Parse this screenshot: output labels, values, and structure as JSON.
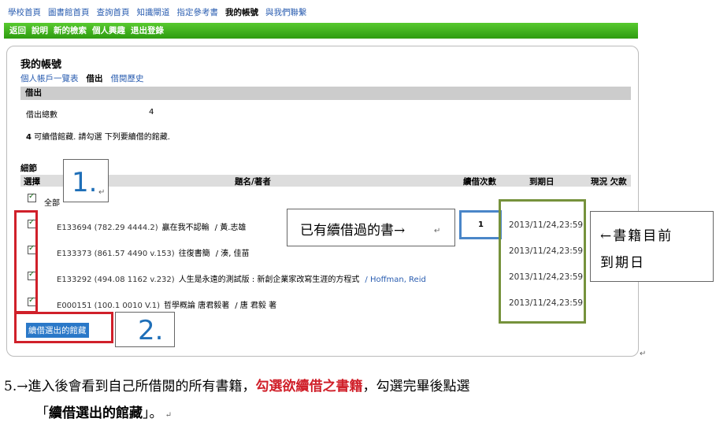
{
  "top_nav": [
    {
      "label": "學校首頁",
      "current": false
    },
    {
      "label": "圖書館首頁",
      "current": false
    },
    {
      "label": "查詢首頁",
      "current": false
    },
    {
      "label": "知識閘道",
      "current": false
    },
    {
      "label": "指定參考書",
      "current": false
    },
    {
      "label": "我的帳號",
      "current": true
    },
    {
      "label": "與我們聯繫",
      "current": false
    }
  ],
  "green_nav": [
    "返回",
    "說明",
    "新的檢索",
    "個人興趣",
    "退出登錄"
  ],
  "account": {
    "title": "我的帳號",
    "tabs": [
      {
        "label": "個人帳戶一覽表",
        "active": false
      },
      {
        "label": "借出",
        "active": true
      },
      {
        "label": "借閱歷史",
        "active": false
      }
    ],
    "loans_header": "借出",
    "total_label": "借出總數",
    "total_value": "4",
    "renew_count": "4",
    "renew_msg": "可續借館藏. 請勾選 下列要續借的館藏."
  },
  "details": {
    "header": "細節",
    "col_select": "選擇",
    "col_title": "題名/著者",
    "col_renewals": "續借次數",
    "col_due": "到期日",
    "col_status": "現況 欠款",
    "select_all": "全部",
    "rows": [
      {
        "call": "E133694 (782.29 4444.2)",
        "title": "贏在我不認輸",
        "author": "/ 黃.志雄",
        "renewals": "1",
        "due": "2013/11/24,23:59"
      },
      {
        "call": "E133373 (861.57 4490 v.153)",
        "title": "往復書簡",
        "author": "/ 湊, 佳苗",
        "renewals": "",
        "due": "2013/11/24,23:59"
      },
      {
        "call": "E133292 (494.08 1162 v.232)",
        "title": "人生是永遠的測試版 : 新創企業家改寫生涯的方程式",
        "author": "/ Hoffman, Reid",
        "renewals": "",
        "due": "2013/11/24,23:59"
      },
      {
        "call": "E000151 (100.1 0010 V.1)",
        "title": "哲學概論 唐君毅著",
        "author": "/ 唐 君毅 著",
        "renewals": "",
        "due": "2013/11/24,23:59"
      }
    ],
    "renew_button": "續借選出的館藏"
  },
  "annotations": {
    "step1": "1.",
    "step2": "2.",
    "renewed_note": "已有續借過的書→",
    "due_note_line1": "←書籍目前",
    "due_note_line2": "到期日",
    "colors": {
      "red": "#d0202a",
      "blue": "#4a86c8",
      "green": "#76923c"
    }
  },
  "footnote": {
    "line1_prefix": "5.→進入後會看到自己所借閱的所有書籍，",
    "line1_highlight": "勾選欲續借之書籍",
    "line1_suffix": "，勾選完畢後點選",
    "line2_open": "「",
    "line2_bold": "續借選出的館藏",
    "line2_close": "」。"
  }
}
